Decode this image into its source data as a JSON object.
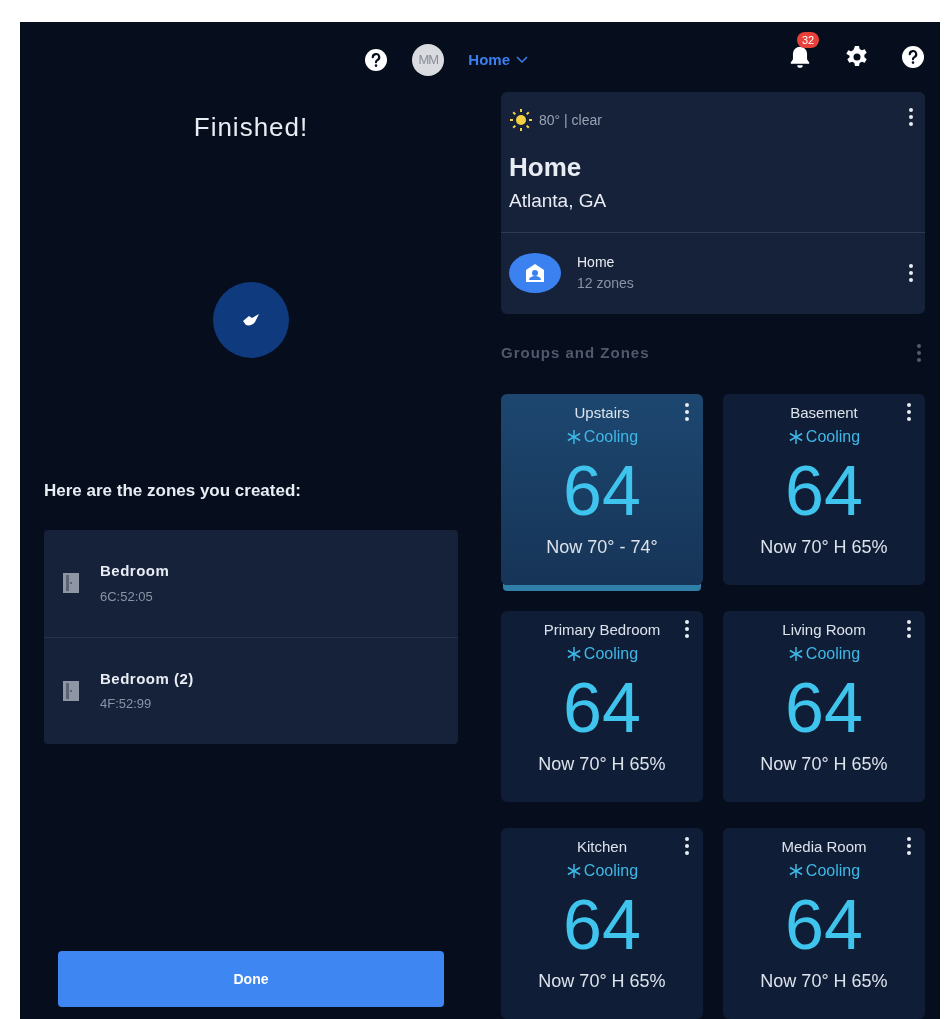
{
  "top_bar": {
    "avatar": "MM",
    "location": "Home",
    "notification_count": "32"
  },
  "setup": {
    "title": "Finished!",
    "heading": "Here are the zones you created:",
    "zones": [
      {
        "name": "Bedroom",
        "address": "6C:52:05"
      },
      {
        "name": "Bedroom (2)",
        "address": "4F:52:99"
      }
    ],
    "button": "Done"
  },
  "home_card": {
    "weather": "80° | clear",
    "title": "Home",
    "location": "Atlanta, GA",
    "group": {
      "name": "Home",
      "count": "12 zones"
    }
  },
  "section_title": "Groups and Zones",
  "zones": [
    {
      "name": "Upstairs",
      "mode": "Cooling",
      "setpoint": "64",
      "reading": "Now 70° - 74°",
      "selected": true
    },
    {
      "name": "Basement",
      "mode": "Cooling",
      "setpoint": "64",
      "reading": "Now 70° H 65%",
      "selected": false
    },
    {
      "name": "Primary Bedroom",
      "mode": "Cooling",
      "setpoint": "64",
      "reading": "Now 70° H 65%",
      "selected": false
    },
    {
      "name": "Living Room",
      "mode": "Cooling",
      "setpoint": "64",
      "reading": "Now 70° H 65%",
      "selected": false
    },
    {
      "name": "Kitchen",
      "mode": "Cooling",
      "setpoint": "64",
      "reading": "Now 70° H 65%",
      "selected": false
    },
    {
      "name": "Media Room",
      "mode": "Cooling",
      "setpoint": "64",
      "reading": "Now 70° H 65%",
      "selected": false
    }
  ]
}
